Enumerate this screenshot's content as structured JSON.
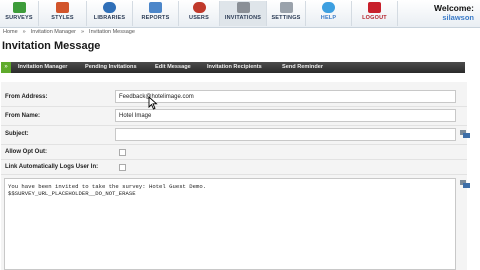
{
  "nav": {
    "items": [
      {
        "label": "SURVEYS",
        "color": "#3d9c3a"
      },
      {
        "label": "STYLES",
        "color": "#d2552c"
      },
      {
        "label": "LIBRARIES",
        "color": "#2f6fb8"
      },
      {
        "label": "REPORTS",
        "color": "#4c86c9"
      },
      {
        "label": "USERS",
        "color": "#c0392b"
      },
      {
        "label": "INVITATIONS",
        "color": "#8a8f96"
      },
      {
        "label": "SETTINGS",
        "color": "#9aa2ab"
      },
      {
        "label": "HELP",
        "color": "#3d9fe0"
      },
      {
        "label": "LOGOUT",
        "color": "#c8202b"
      }
    ],
    "welcome": "Welcome:",
    "username": "silawson"
  },
  "breadcrumb": [
    "Home",
    "»",
    "Invitation Manager",
    "»",
    "Invitation Message"
  ],
  "page_title": "Invitation Message",
  "subnav": {
    "first": "»",
    "tabs": [
      "Invitation Manager",
      "Pending Invitations",
      "Edit Message",
      "Invitation Recipients",
      "Send Reminder"
    ]
  },
  "form": {
    "from_address_label": "From Address:",
    "from_address_value": "Feedback@hotelimage.com",
    "from_name_label": "From Name:",
    "from_name_value": "Hotel Image",
    "subject_label": "Subject:",
    "subject_value": "",
    "allow_opt_out_label": "Allow Opt Out:",
    "link_auto_login_label": "Link Automatically Logs User In:",
    "body_lines": [
      "You have been invited to take the survey: Hotel Guest Demo.",
      "",
      "$$SURVEY_URL_PLACEHOLDER__DO_NOT_ERASE"
    ]
  }
}
